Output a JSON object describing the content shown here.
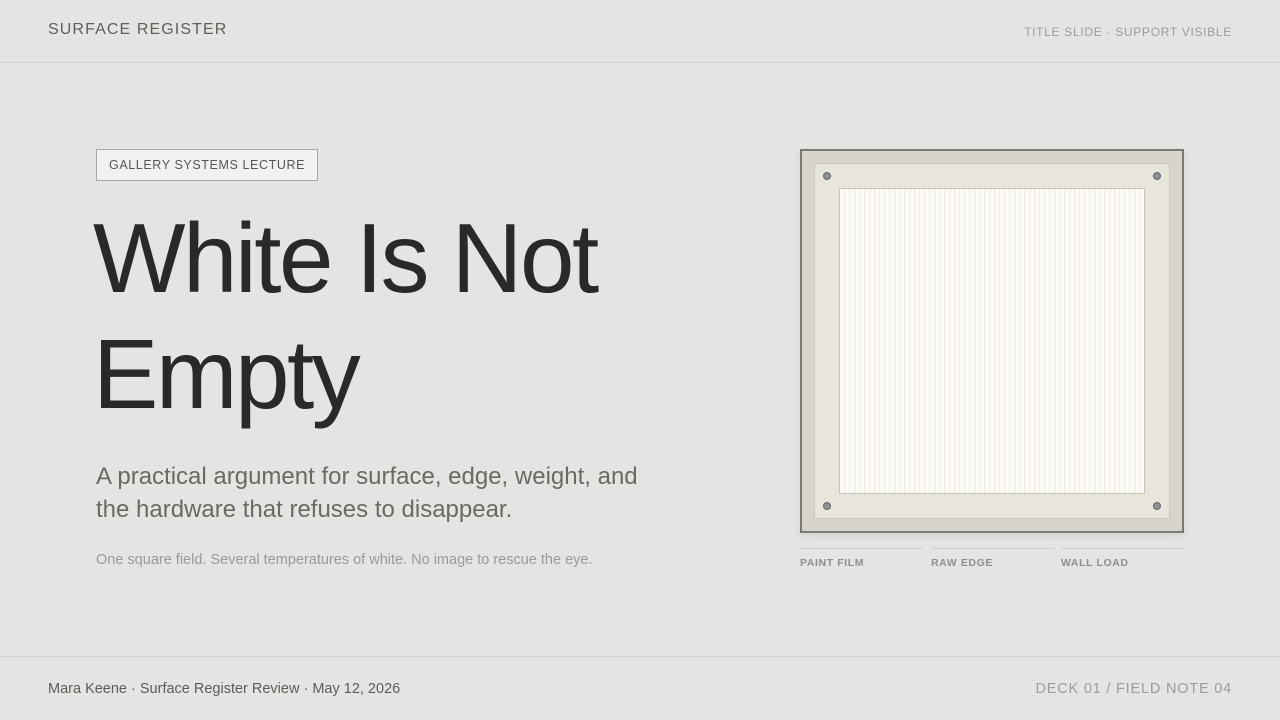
{
  "header": {
    "brand": "SURFACE REGISTER",
    "slide_label": "TITLE SLIDE · SUPPORT VISIBLE"
  },
  "hero": {
    "kicker": "GALLERY SYSTEMS LECTURE",
    "title": "White Is Not Empty",
    "subtitle": "A practical argument for surface, edge, weight, and the hardware that refuses to disappear.",
    "note": "One square field. Several temperatures of white. No image to rescue the eye."
  },
  "panel": {
    "legend": [
      "PAINT FILM",
      "RAW EDGE",
      "WALL LOAD"
    ]
  },
  "footer": {
    "byline": "Mara Keene · Surface Register Review · May 12, 2026",
    "deck_label": "DECK 01 / FIELD NOTE 04"
  },
  "colors": {
    "background": "#e4e4e2",
    "text_primary": "#292927",
    "text_muted": "#979a9d",
    "panel_frame": "#7a7a72"
  }
}
